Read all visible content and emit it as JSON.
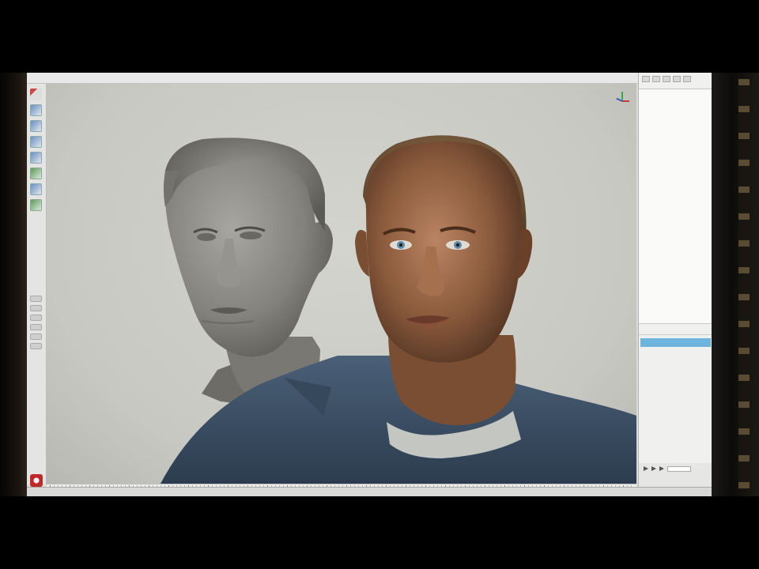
{
  "app": {
    "menu": [
      "",
      "",
      "",
      "",
      "",
      "",
      ""
    ]
  },
  "hud": {
    "rows": [
      {
        "label": "",
        "v1": "",
        "v2": "",
        "v3": ""
      },
      {
        "label": "",
        "v1": "",
        "v2": "",
        "v3": ""
      },
      {
        "label": "",
        "v1": "",
        "v2": "",
        "v3": ""
      },
      {
        "label": "",
        "v1": "",
        "v2": "",
        "v3": ""
      },
      {
        "label": "",
        "v1": "",
        "v2": "",
        "v3": ""
      }
    ]
  },
  "right_panel": {
    "tabs": [
      "",
      ""
    ],
    "layer_tabs": [
      "",
      ""
    ],
    "layer_sub": [
      "",
      "",
      ""
    ],
    "layers": [
      {
        "label": "",
        "selected": true
      },
      {
        "label": "",
        "selected": false
      },
      {
        "label": "",
        "selected": false
      },
      {
        "label": "",
        "selected": false
      }
    ]
  },
  "colors": {
    "viewport_bg": "#c8c8c2",
    "sculpt_grey": "#8c8a84",
    "skin": "#9a6a4a",
    "shirt": "#3e546a",
    "selection": "#6fb4dc"
  },
  "icons": [
    "select-arrow-icon",
    "move-icon",
    "rotate-icon",
    "scale-icon",
    "sculpt-brush-icon",
    "axis-gizmo-icon",
    "app-logo-icon"
  ]
}
